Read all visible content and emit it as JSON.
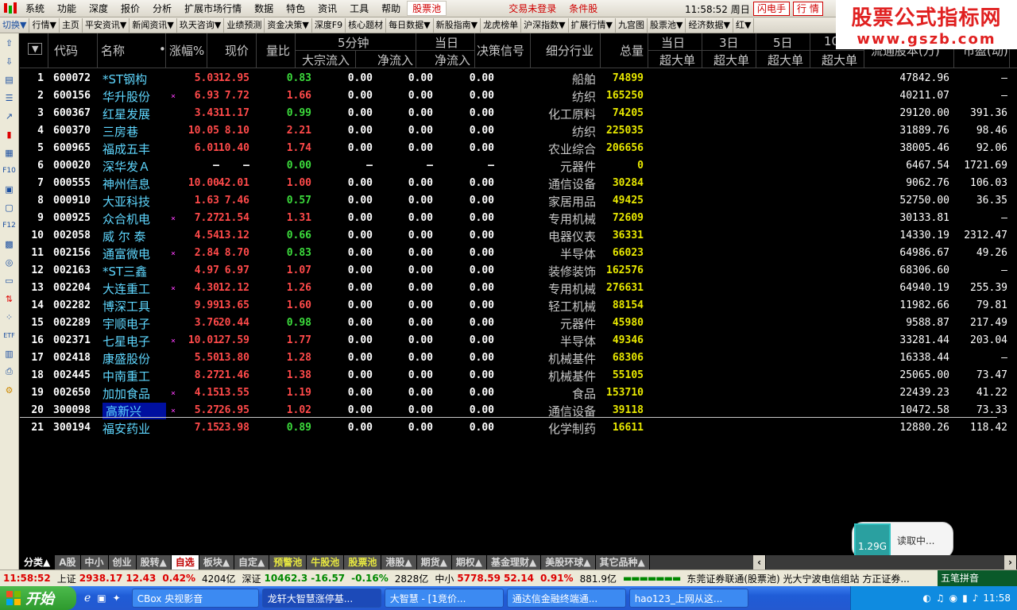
{
  "menubar": {
    "items": [
      "系统",
      "功能",
      "深度",
      "报价",
      "分析",
      "扩展市场行情",
      "数据",
      "特色",
      "资讯",
      "工具",
      "帮助"
    ],
    "pool_label": "股票池",
    "trade_status": "交易未登录",
    "condition_label": "条件股",
    "clock": "11:58:52 周日",
    "flash_btn": "闪电手",
    "quote_btn": "行 情"
  },
  "watermark": {
    "title": "股票公式指标网",
    "url": "www.gszb.com"
  },
  "toolbar2": [
    "切换▼",
    "行情▼",
    "主页",
    "平安资讯▼",
    "新闻资讯▼",
    "玖天咨询▼",
    "业绩预测",
    "资金决策▼",
    "深度F9",
    "核心题材",
    "每日数据▼",
    "新股指南▼",
    "龙虎榜单",
    "沪深指数▼",
    "扩展行情▼",
    "九宫图",
    "股票池▼",
    "经济数据▼",
    "红▼"
  ],
  "header": {
    "code": "代码",
    "name": "名称",
    "dot": "•",
    "chg": "涨幅%",
    "price": "现价",
    "ratio": "量比",
    "five_min": "5分钟",
    "today": "当日",
    "block_inflow": "大宗流入",
    "net_inflow": "净流入",
    "today_net": "净流入",
    "signal": "决策信号",
    "industry": "细分行业",
    "volume": "总量",
    "d1": "当日",
    "d3": "3日",
    "d5": "5日",
    "d10": "10",
    "big": "超大单",
    "float": "流通股本(万)",
    "pe": "市盈(动)"
  },
  "rows": [
    {
      "idx": "1",
      "code": "600072",
      "name": "*ST钢构",
      "mark": "",
      "chg": "5.03",
      "price": "12.95",
      "ratio": "0.83",
      "f1": "0.00",
      "f2": "0.00",
      "f3": "0.00",
      "ind": "船舶",
      "vol": "74899",
      "float": "47842.96",
      "pe": "–",
      "up": true,
      "rup": false
    },
    {
      "idx": "2",
      "code": "600156",
      "name": "华升股份",
      "mark": "×",
      "chg": "6.93",
      "price": "7.72",
      "ratio": "1.66",
      "f1": "0.00",
      "f2": "0.00",
      "f3": "0.00",
      "ind": "纺织",
      "vol": "165250",
      "float": "40211.07",
      "pe": "–",
      "up": true,
      "rup": true
    },
    {
      "idx": "3",
      "code": "600367",
      "name": "红星发展",
      "mark": "",
      "chg": "3.43",
      "price": "11.17",
      "ratio": "0.99",
      "f1": "0.00",
      "f2": "0.00",
      "f3": "0.00",
      "ind": "化工原料",
      "vol": "74205",
      "float": "29120.00",
      "pe": "391.36",
      "up": true,
      "rup": false
    },
    {
      "idx": "4",
      "code": "600370",
      "name": "三房巷",
      "mark": "",
      "chg": "10.05",
      "price": "8.10",
      "ratio": "2.21",
      "f1": "0.00",
      "f2": "0.00",
      "f3": "0.00",
      "ind": "纺织",
      "vol": "225035",
      "float": "31889.76",
      "pe": "98.46",
      "up": true,
      "rup": true
    },
    {
      "idx": "5",
      "code": "600965",
      "name": "福成五丰",
      "mark": "",
      "chg": "6.01",
      "price": "10.40",
      "ratio": "1.74",
      "f1": "0.00",
      "f2": "0.00",
      "f3": "0.00",
      "ind": "农业综合",
      "vol": "206656",
      "float": "38005.46",
      "pe": "92.06",
      "up": true,
      "rup": true
    },
    {
      "idx": "6",
      "code": "000020",
      "name": "深华发Ａ",
      "mark": "",
      "chg": "–",
      "price": "–",
      "ratio": "0.00",
      "f1": "–",
      "f2": "–",
      "f3": "–",
      "ind": "元器件",
      "vol": "0",
      "float": "6467.54",
      "pe": "1721.69",
      "up": false,
      "rup": false
    },
    {
      "idx": "7",
      "code": "000555",
      "name": "神州信息",
      "mark": "",
      "chg": "10.00",
      "price": "42.01",
      "ratio": "1.00",
      "f1": "0.00",
      "f2": "0.00",
      "f3": "0.00",
      "ind": "通信设备",
      "vol": "30284",
      "float": "9062.76",
      "pe": "106.03",
      "up": true,
      "rup": true
    },
    {
      "idx": "8",
      "code": "000910",
      "name": "大亚科技",
      "mark": "",
      "chg": "1.63",
      "price": "7.46",
      "ratio": "0.57",
      "f1": "0.00",
      "f2": "0.00",
      "f3": "0.00",
      "ind": "家居用品",
      "vol": "49425",
      "float": "52750.00",
      "pe": "36.35",
      "up": true,
      "rup": false
    },
    {
      "idx": "9",
      "code": "000925",
      "name": "众合机电",
      "mark": "×",
      "chg": "7.27",
      "price": "21.54",
      "ratio": "1.31",
      "f1": "0.00",
      "f2": "0.00",
      "f3": "0.00",
      "ind": "专用机械",
      "vol": "72609",
      "float": "30133.81",
      "pe": "–",
      "up": true,
      "rup": true
    },
    {
      "idx": "10",
      "code": "002058",
      "name": "威 尔 泰",
      "mark": "",
      "chg": "4.54",
      "price": "13.12",
      "ratio": "0.66",
      "f1": "0.00",
      "f2": "0.00",
      "f3": "0.00",
      "ind": "电器仪表",
      "vol": "36331",
      "float": "14330.19",
      "pe": "2312.47",
      "up": true,
      "rup": false
    },
    {
      "idx": "11",
      "code": "002156",
      "name": "通富微电",
      "mark": "×",
      "chg": "2.84",
      "price": "8.70",
      "ratio": "0.83",
      "f1": "0.00",
      "f2": "0.00",
      "f3": "0.00",
      "ind": "半导体",
      "vol": "66023",
      "float": "64986.67",
      "pe": "49.26",
      "up": true,
      "rup": false
    },
    {
      "idx": "12",
      "code": "002163",
      "name": "*ST三鑫",
      "mark": "",
      "chg": "4.97",
      "price": "6.97",
      "ratio": "1.07",
      "f1": "0.00",
      "f2": "0.00",
      "f3": "0.00",
      "ind": "装修装饰",
      "vol": "162576",
      "float": "68306.60",
      "pe": "–",
      "up": true,
      "rup": true
    },
    {
      "idx": "13",
      "code": "002204",
      "name": "大连重工",
      "mark": "×",
      "chg": "4.30",
      "price": "12.12",
      "ratio": "1.26",
      "f1": "0.00",
      "f2": "0.00",
      "f3": "0.00",
      "ind": "专用机械",
      "vol": "276631",
      "float": "64940.19",
      "pe": "255.39",
      "up": true,
      "rup": true
    },
    {
      "idx": "14",
      "code": "002282",
      "name": "博深工具",
      "mark": "",
      "chg": "9.99",
      "price": "13.65",
      "ratio": "1.60",
      "f1": "0.00",
      "f2": "0.00",
      "f3": "0.00",
      "ind": "轻工机械",
      "vol": "88154",
      "float": "11982.66",
      "pe": "79.81",
      "up": true,
      "rup": true
    },
    {
      "idx": "15",
      "code": "002289",
      "name": "宇顺电子",
      "mark": "",
      "chg": "3.76",
      "price": "20.44",
      "ratio": "0.98",
      "f1": "0.00",
      "f2": "0.00",
      "f3": "0.00",
      "ind": "元器件",
      "vol": "45980",
      "float": "9588.87",
      "pe": "217.49",
      "up": true,
      "rup": false
    },
    {
      "idx": "16",
      "code": "002371",
      "name": "七星电子",
      "mark": "×",
      "chg": "10.01",
      "price": "27.59",
      "ratio": "1.77",
      "f1": "0.00",
      "f2": "0.00",
      "f3": "0.00",
      "ind": "半导体",
      "vol": "49346",
      "float": "33281.44",
      "pe": "203.04",
      "up": true,
      "rup": true
    },
    {
      "idx": "17",
      "code": "002418",
      "name": "康盛股份",
      "mark": "",
      "chg": "5.50",
      "price": "13.80",
      "ratio": "1.28",
      "f1": "0.00",
      "f2": "0.00",
      "f3": "0.00",
      "ind": "机械基件",
      "vol": "68306",
      "float": "16338.44",
      "pe": "–",
      "up": true,
      "rup": true
    },
    {
      "idx": "18",
      "code": "002445",
      "name": "中南重工",
      "mark": "",
      "chg": "8.27",
      "price": "21.46",
      "ratio": "1.38",
      "f1": "0.00",
      "f2": "0.00",
      "f3": "0.00",
      "ind": "机械基件",
      "vol": "55105",
      "float": "25065.00",
      "pe": "73.47",
      "up": true,
      "rup": true
    },
    {
      "idx": "19",
      "code": "002650",
      "name": "加加食品",
      "mark": "×",
      "chg": "4.15",
      "price": "13.55",
      "ratio": "1.19",
      "f1": "0.00",
      "f2": "0.00",
      "f3": "0.00",
      "ind": "食品",
      "vol": "153710",
      "float": "22439.23",
      "pe": "41.22",
      "up": true,
      "rup": true
    },
    {
      "idx": "20",
      "code": "300098",
      "name": "高新兴",
      "mark": "×",
      "chg": "5.27",
      "price": "26.95",
      "ratio": "1.02",
      "f1": "0.00",
      "f2": "0.00",
      "f3": "0.00",
      "ind": "通信设备",
      "vol": "39118",
      "float": "10472.58",
      "pe": "73.33",
      "up": true,
      "rup": true,
      "selected": true
    },
    {
      "idx": "21",
      "code": "300194",
      "name": "福安药业",
      "mark": "",
      "chg": "7.15",
      "price": "23.98",
      "ratio": "0.89",
      "f1": "0.00",
      "f2": "0.00",
      "f3": "0.00",
      "ind": "化学制药",
      "vol": "16611",
      "float": "12880.26",
      "pe": "118.42",
      "up": true,
      "rup": false
    }
  ],
  "tabs": [
    "分类▲",
    "A股",
    "中小",
    "创业",
    "股转▲",
    "自选",
    "板块▲",
    "自定▲",
    "预警池",
    "牛股池",
    "股票池",
    "港股▲",
    "期货▲",
    "期权▲",
    "基金理财▲",
    "美股环球▲",
    "其它品种▲"
  ],
  "popup": {
    "meter": "1.29G",
    "text": "读取中..."
  },
  "status": {
    "time": "11:58:52",
    "sh_label": "上证",
    "sh_val": "2938.17",
    "sh_chg": "12.43",
    "sh_pct": "0.42%",
    "sh_amt": "4204亿",
    "sz_label": "深证",
    "sz_val": "10462.3",
    "sz_chg": "-16.57",
    "sz_pct": "-0.16%",
    "sz_amt": "2828亿",
    "zx_label": "中小",
    "zx_val": "5778.59",
    "zx_chg": "52.14",
    "zx_pct": "0.91%",
    "zx_amt": "881.9亿",
    "ticker": "东莞证券联通(股票池) 光大宁波电信组站 方正证券...",
    "ime": "五笔拼音"
  },
  "taskbar": {
    "start": "开始",
    "items": [
      "CBox 央视影音",
      "龙轩大智慧涨停基...",
      "大智慧 - [1竞价...",
      "通达信金融终端通...",
      "hao123_上网从这..."
    ],
    "clock": "11:58"
  }
}
